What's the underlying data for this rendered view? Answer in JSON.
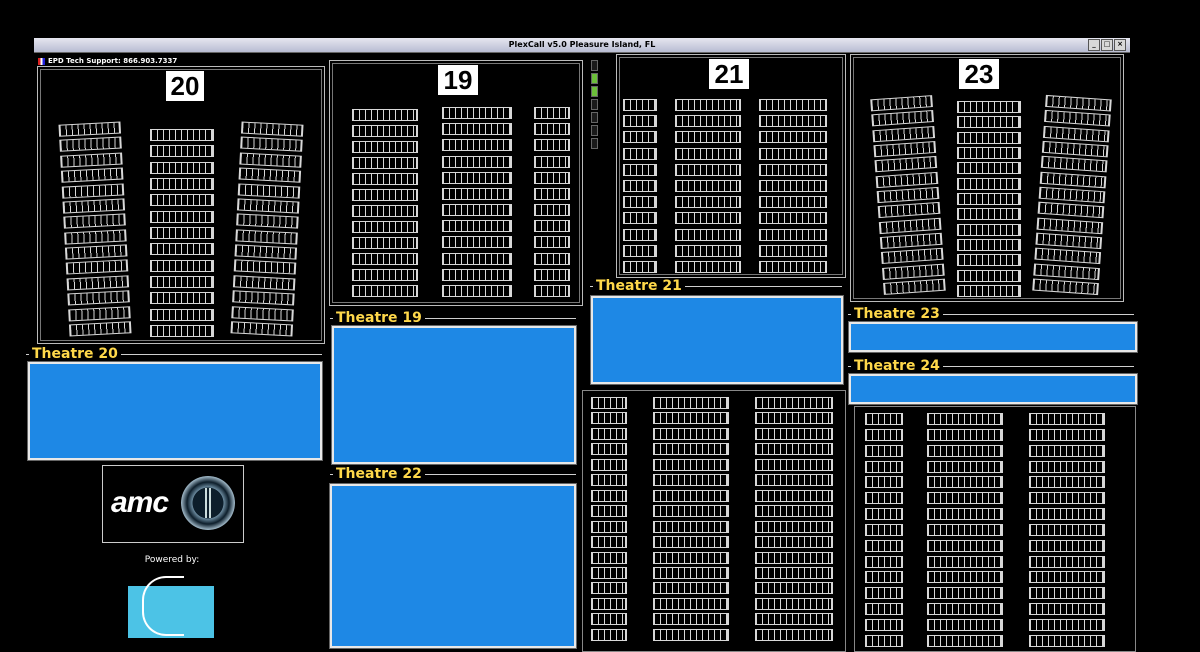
{
  "window": {
    "title": "PlexCall v5.0  Pleasure Island, FL",
    "controls": [
      "_",
      "□",
      "×"
    ]
  },
  "support_text": "EPD Tech Support: 866.903.7337",
  "auditoriums": [
    {
      "number": "20"
    },
    {
      "number": "19"
    },
    {
      "number": "21"
    },
    {
      "number": "23"
    }
  ],
  "theatres": {
    "t20": "Theatre 20",
    "t19": "Theatre 19",
    "t21": "Theatre 21",
    "t22": "Theatre 22",
    "t23": "Theatre 23",
    "t24": "Theatre 24"
  },
  "logo": {
    "brand": "amc",
    "powered_by": "Powered by:"
  },
  "colors": {
    "status_panel": "#1e88e5",
    "label": "#ffd84a",
    "background": "#000000"
  },
  "indicators": [
    "off",
    "green",
    "green",
    "off",
    "off",
    "off",
    "off"
  ]
}
